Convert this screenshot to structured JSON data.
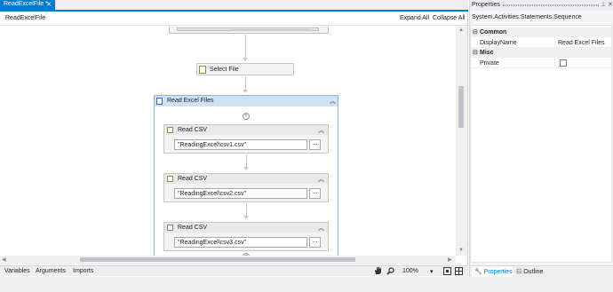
{
  "document_tab": {
    "label": "ReadExcelFile *",
    "close_glyph": "✕"
  },
  "designer": {
    "breadcrumb": "ReadExcelFile",
    "expand_all": "Expand All",
    "collapse_all": "Collapse All",
    "activities": {
      "select_file": "Select File",
      "sequence_title": "Read Excel Files",
      "read_csv": [
        {
          "title": "Read CSV",
          "path": "\"ReadingExcel\\csv1.csv\"",
          "browse": "..."
        },
        {
          "title": "Read CSV",
          "path": "\"ReadingExcel\\csv2.csv\"",
          "browse": "..."
        },
        {
          "title": "Read CSV",
          "path": "\"ReadingExcel\\csv3.csv\"",
          "browse": "..."
        }
      ]
    }
  },
  "bottom_bar": {
    "variables": "Variables",
    "arguments": "Arguments",
    "imports": "Imports",
    "zoom": "100%",
    "zoom_dropdown_glyph": "▾"
  },
  "properties": {
    "title": "Properties",
    "type_name": "System.Activities.Statements.Sequence",
    "categories": [
      {
        "name": "Common",
        "rows": [
          {
            "key": "DisplayName",
            "value": "Read Excel Files"
          }
        ]
      },
      {
        "name": "Misc",
        "rows": [
          {
            "key": "Private",
            "value": false
          }
        ]
      }
    ],
    "tabs": {
      "properties": "Properties",
      "outline": "Outline"
    }
  },
  "icons": {
    "pan": "hand-icon",
    "search": "search-icon",
    "fit": "fit-to-screen-icon",
    "overview": "overview-icon",
    "collapse": "double-chevron-up-icon",
    "add": "plus-icon",
    "wrench": "wrench-icon",
    "outline": "outline-icon"
  },
  "colors": {
    "accent": "#007acc",
    "sequence_header": "#cfe2f5"
  }
}
